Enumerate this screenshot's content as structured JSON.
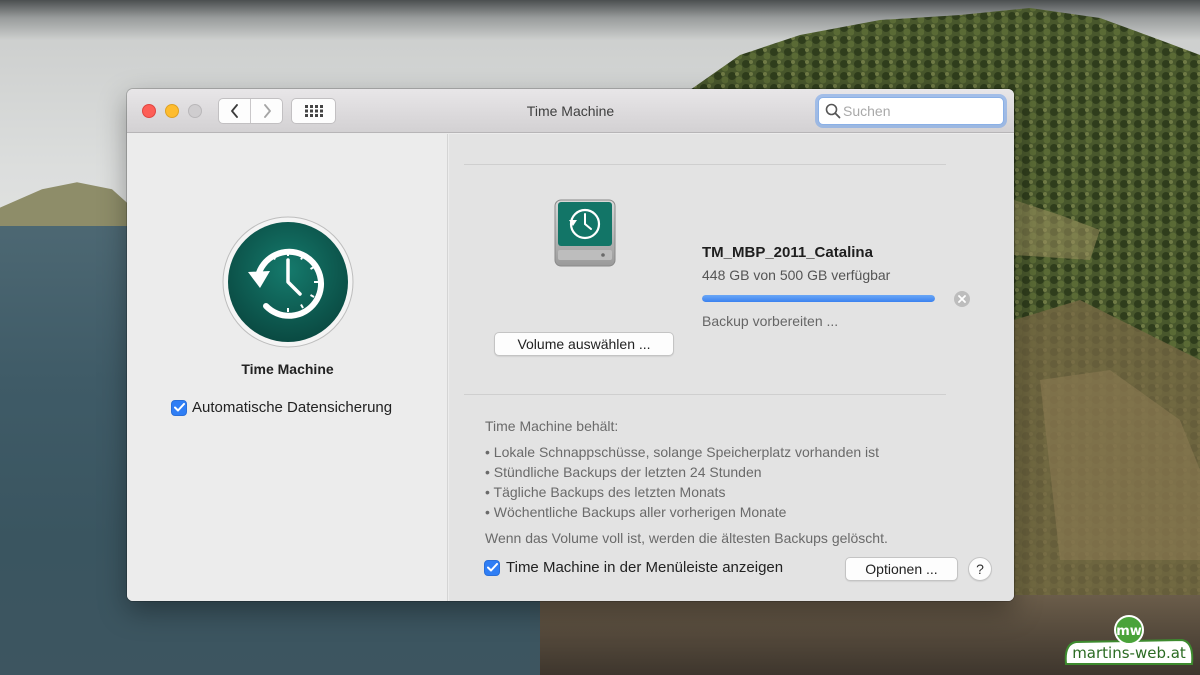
{
  "window": {
    "title": "Time Machine",
    "search_placeholder": "Suchen",
    "nav_back": "‹",
    "nav_forward": "›"
  },
  "left_pane": {
    "title": "Time Machine",
    "auto_backup_label": "Automatische Datensicherung",
    "auto_backup_checked": true
  },
  "backup_disk": {
    "name": "TM_MBP_2011_Catalina",
    "free_space": "448 GB von 500 GB verfügbar",
    "progress": 1.0,
    "status": "Backup vorbereiten ...",
    "select_button": "Volume auswählen ..."
  },
  "info": {
    "heading": "Time Machine behält:",
    "items": [
      "Lokale Schnappschüsse, solange Speicherplatz vorhanden ist",
      "Stündliche Backups der letzten 24 Stunden",
      "Tägliche Backups des letzten Monats",
      "Wöchentliche Backups aller vorherigen Monate"
    ],
    "footer": "Wenn das Volume voll ist, werden die ältesten Backups gelöscht."
  },
  "bottom": {
    "menubar_label": "Time Machine in der Menüleiste anzeigen",
    "menubar_checked": true,
    "options_button": "Optionen ...",
    "help_button": "?"
  },
  "watermark": {
    "logo_letters": "mw",
    "text": "martins-web.at"
  },
  "colors": {
    "accent": "#2f7ef5",
    "tm_icon_green": "#0f5d54"
  }
}
